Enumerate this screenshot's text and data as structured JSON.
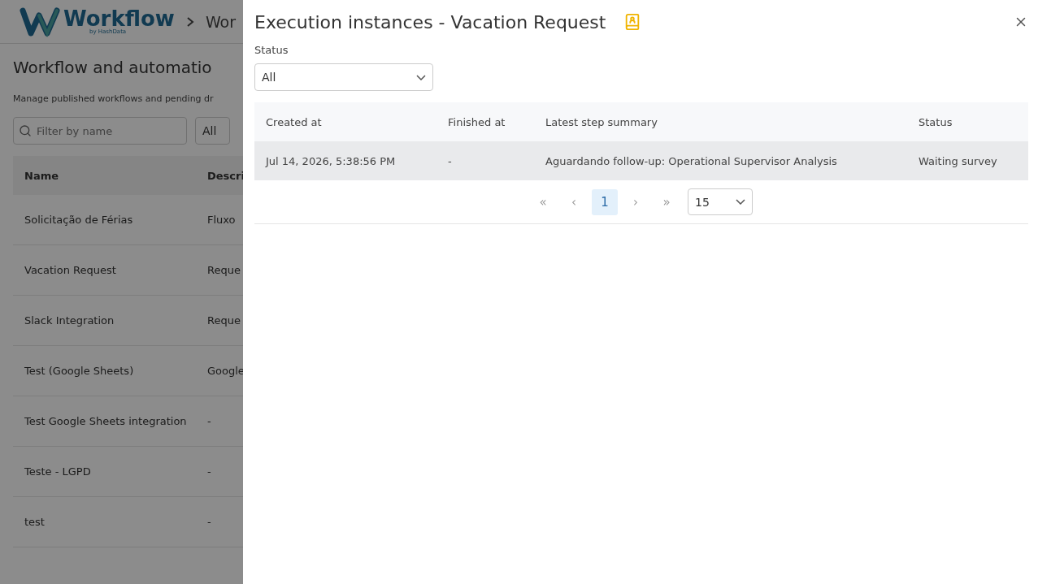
{
  "app": {
    "logo_name": "Workflow",
    "logo_byline": "by HashData",
    "breadcrumb": "Wor"
  },
  "page": {
    "title": "Workflow and automatio",
    "subtitle": "Manage published workflows and pending dr",
    "filter": {
      "placeholder": "Filter by name"
    },
    "type_select": {
      "value": "All"
    },
    "table": {
      "columns": [
        "Name",
        "Descri"
      ],
      "rows": [
        {
          "name": "Solicitação de Férias",
          "description": "Fluxo"
        },
        {
          "name": "Vacation Request",
          "description": "Reque"
        },
        {
          "name": "Slack Integration",
          "description": "Reque"
        },
        {
          "name": "Test (Google Sheets)",
          "description": "Google"
        },
        {
          "name": "Test Google Sheets integration",
          "description": "-"
        },
        {
          "name": "Teste - LGPD",
          "description": "-"
        },
        {
          "name": "test",
          "description": "-"
        }
      ]
    }
  },
  "drawer": {
    "title": "Execution instances - Vacation Request",
    "status_label": "Status",
    "status_select": {
      "value": "All"
    },
    "table": {
      "columns": [
        "Created at",
        "Finished at",
        "Latest step summary",
        "Status"
      ],
      "rows": [
        {
          "created_at": "Jul 14, 2026, 5:38:56 PM",
          "finished_at": "-",
          "summary": "Aguardando follow-up: Operational Supervisor Analysis",
          "status": "Waiting survey",
          "hovered": true
        }
      ]
    },
    "pagination": {
      "first": "«",
      "prev": "‹",
      "pages": [
        {
          "label": "1",
          "selected": true
        }
      ],
      "next": "›",
      "last": "»",
      "page_size": "15"
    }
  }
}
